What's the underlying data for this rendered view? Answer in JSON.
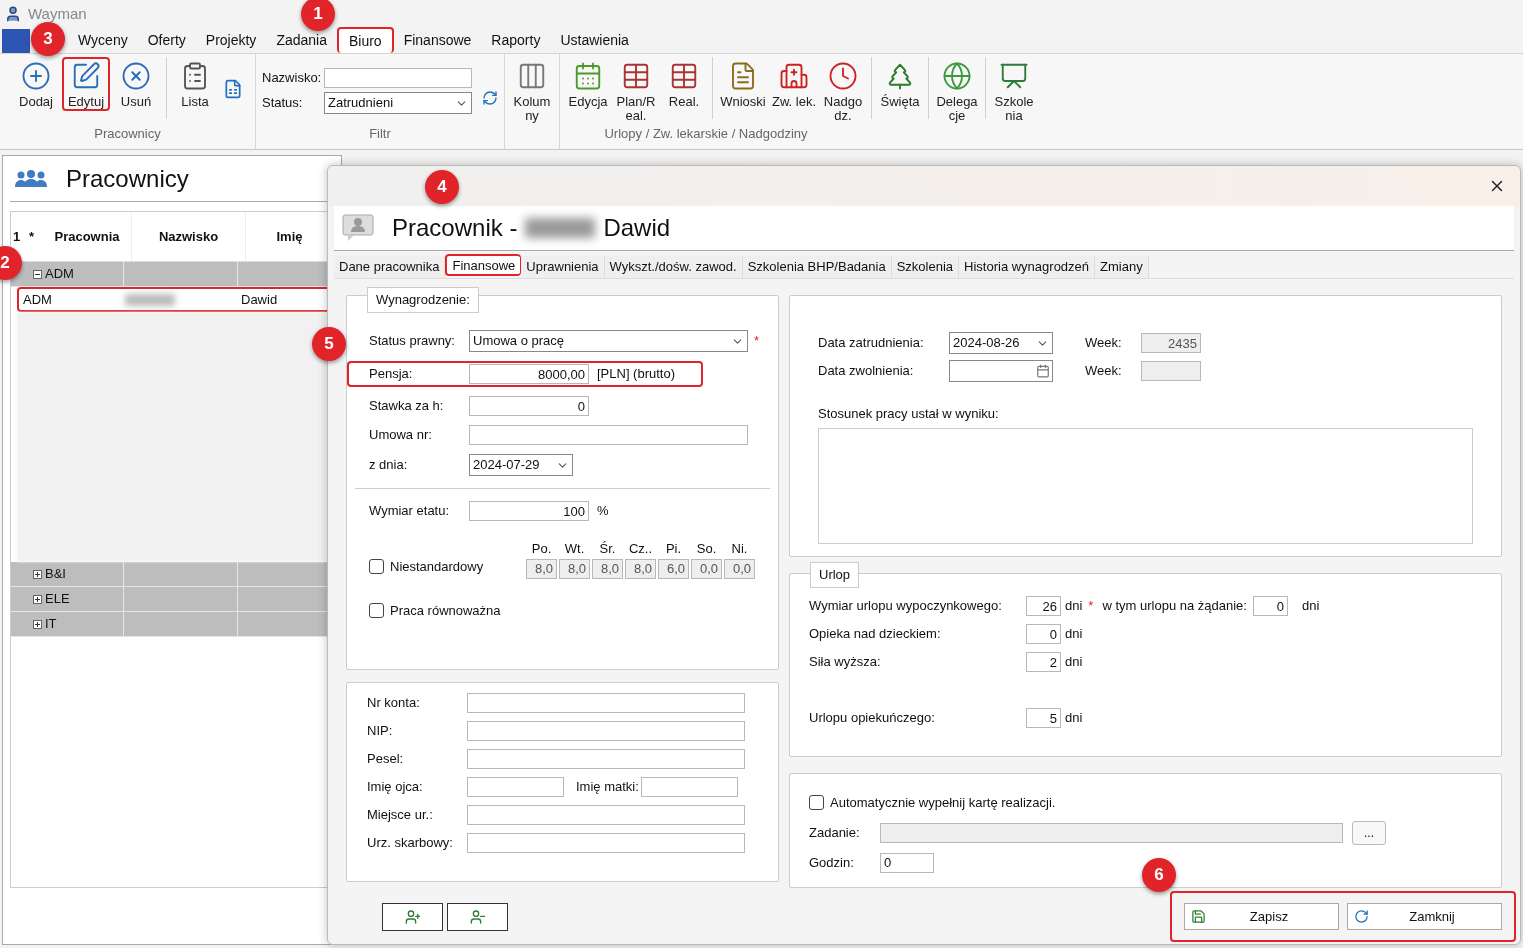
{
  "app_title": "Wayman",
  "menu_tabs": [
    {
      "label": "Wyceny",
      "selected": false,
      "highlighted": false
    },
    {
      "label": "Oferty",
      "selected": false,
      "highlighted": false
    },
    {
      "label": "Projekty",
      "selected": false,
      "highlighted": false
    },
    {
      "label": "Zadania",
      "selected": false,
      "highlighted": false
    },
    {
      "label": "Biuro",
      "selected": true,
      "highlighted": true
    },
    {
      "label": "Finansowe",
      "selected": false,
      "highlighted": false
    },
    {
      "label": "Raporty",
      "selected": false,
      "highlighted": false
    },
    {
      "label": "Ustawienia",
      "selected": false,
      "highlighted": false
    }
  ],
  "ribbon": {
    "pracownicy": {
      "label": "Pracownicy",
      "buttons": [
        {
          "label": "Dodaj",
          "highlighted": false
        },
        {
          "label": "Edytuj",
          "highlighted": true
        },
        {
          "label": "Usuń",
          "highlighted": false
        },
        {
          "label": "Lista",
          "highlighted": false
        }
      ]
    },
    "filtr": {
      "label": "Filtr",
      "name_label": "Nazwisko:",
      "status_label": "Status:",
      "status_value": "Zatrudnieni"
    },
    "kolumny": {
      "label": "Kolumny"
    },
    "urlopy": {
      "label": "Urlopy / Zw. lekarskie / Nadgodziny",
      "buttons": [
        {
          "label": "Edycja"
        },
        {
          "label": "Plan/Real."
        },
        {
          "label": "Real."
        },
        {
          "label": "Wnioski"
        },
        {
          "label": "Zw. lek."
        },
        {
          "label": "Nadgodz."
        },
        {
          "label": "Święta"
        },
        {
          "label": "Delegacje"
        },
        {
          "label": "Szkolenia"
        }
      ]
    }
  },
  "panel": {
    "title": "Pracownicy",
    "columns": [
      "1",
      "*",
      "Pracownia",
      "Nazwisko",
      "Imię"
    ],
    "groups": [
      {
        "name": "ADM",
        "expanded": true,
        "rows": [
          {
            "pracownia": "ADM",
            "imie": "Dawid",
            "highlighted": true
          }
        ]
      },
      {
        "name": "B&I",
        "expanded": false
      },
      {
        "name": "ELE",
        "expanded": false
      },
      {
        "name": "IT",
        "expanded": false
      }
    ]
  },
  "dialog": {
    "title_prefix": "Pracownik -",
    "title_name": "Dawid",
    "tabs": [
      {
        "label": "Dane pracownika",
        "selected": false
      },
      {
        "label": "Finansowe",
        "selected": true
      },
      {
        "label": "Uprawnienia",
        "selected": false
      },
      {
        "label": "Wykszt./dośw. zawod.",
        "selected": false
      },
      {
        "label": "Szkolenia BHP/Badania",
        "selected": false
      },
      {
        "label": "Szkolenia",
        "selected": false
      },
      {
        "label": "Historia wynagrodzeń",
        "selected": false
      },
      {
        "label": "Zmiany",
        "selected": false
      }
    ],
    "wynagrodzenie": {
      "legend": "Wynagrodzenie:",
      "status": {
        "label": "Status prawny:",
        "value": "Umowa o pracę",
        "mark": "*"
      },
      "pensja": {
        "label": "Pensja:",
        "value": "8000,00",
        "unit": "[PLN] (brutto)"
      },
      "stawka": {
        "label": "Stawka za h:",
        "value": "0"
      },
      "umowa": {
        "label": "Umowa nr:"
      },
      "z_dnia": {
        "label": "z dnia:",
        "value": "2024-07-29"
      },
      "etat": {
        "label": "Wymiar etatu:",
        "value": "100",
        "unit": "%"
      },
      "days": [
        {
          "label": "Po.",
          "value": "8,0"
        },
        {
          "label": "Wt.",
          "value": "8,0"
        },
        {
          "label": "Śr.",
          "value": "8,0"
        },
        {
          "label": "Cz..",
          "value": "8,0"
        },
        {
          "label": "Pi.",
          "value": "6,0"
        },
        {
          "label": "So.",
          "value": "0,0"
        },
        {
          "label": "Ni.",
          "value": "0,0"
        }
      ],
      "checkboxes": [
        {
          "label": "Niestandardowy",
          "checked": false
        },
        {
          "label": "Praca równoważna",
          "checked": false
        }
      ]
    },
    "personal": [
      [
        {
          "label": "Nr konta:"
        }
      ],
      [
        {
          "label": "NIP:"
        }
      ],
      [
        {
          "label": "Pesel:"
        }
      ],
      [
        {
          "label": "Imię ojca:"
        },
        {
          "label": "Imię matki:"
        }
      ],
      [
        {
          "label": "Miejsce ur.:"
        }
      ],
      [
        {
          "label": "Urz. skarbowy:"
        }
      ]
    ],
    "employment": {
      "start_label": "Data zatrudnienia:",
      "start_value": "2024-08-26",
      "week_label": "Week:",
      "week_value": "2435",
      "end_label": "Data zwolnienia:",
      "end_week_label": "Week:",
      "result_label": "Stosunek pracy ustał w wyniku:"
    },
    "urlop": {
      "legend": "Urlop",
      "rows": [
        {
          "label": "Wymiar urlopu wypoczynkowego:",
          "value": "26",
          "unit": "dni",
          "mark": "*",
          "extra_label": "w tym urlopu na żądanie:",
          "extra_value": "0",
          "extra_unit": "dni"
        },
        {
          "label": "Opieka nad dzieckiem:",
          "value": "0",
          "unit": "dni"
        },
        {
          "label": "Siła wyższa:",
          "value": "2",
          "unit": "dni"
        },
        {
          "label": "Urlopu opiekuńczego:",
          "value": "5",
          "unit": "dni"
        }
      ]
    },
    "auto": {
      "checkbox": {
        "label": "Automatycznie wypełnij kartę realizacji.",
        "checked": false
      },
      "task_label": "Zadanie:",
      "browse": "...",
      "hours_label": "Godzin:",
      "hours_value": "0"
    },
    "buttons": [
      {
        "label": "Zapisz"
      },
      {
        "label": "Zamknij"
      }
    ]
  },
  "annotations": [
    {
      "number": "1"
    },
    {
      "number": "2"
    },
    {
      "number": "3"
    },
    {
      "number": "4"
    },
    {
      "number": "5"
    },
    {
      "number": "6"
    }
  ]
}
